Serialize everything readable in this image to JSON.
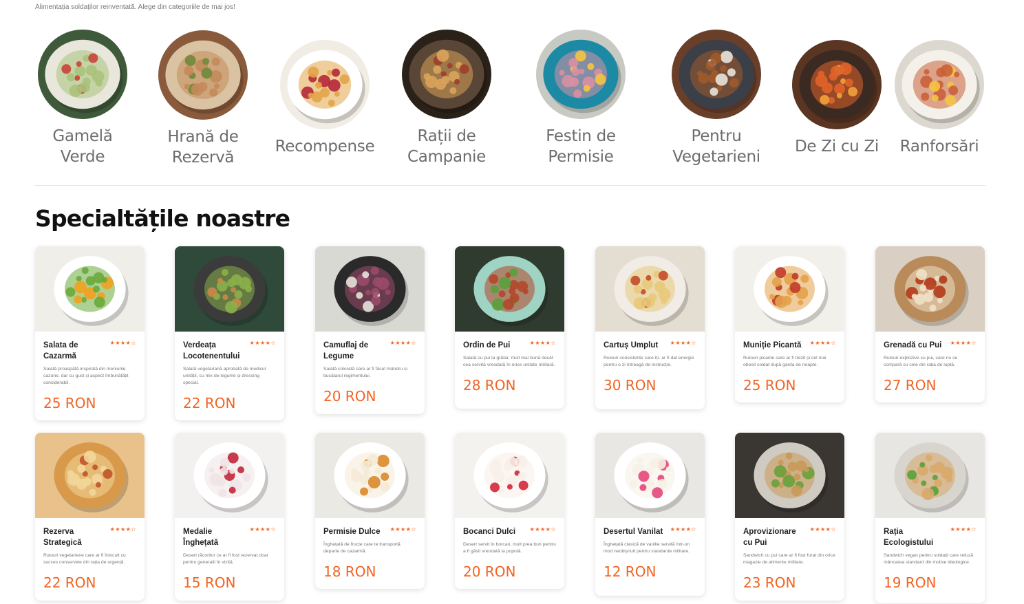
{
  "tagline": "Alimentația soldaților reinventată. Alege din categoriile de mai jos!",
  "categories": [
    {
      "label": "Gamelă\nVerde",
      "l1": "Gamelă",
      "l2": "Verde",
      "bg": "#3f5a3a",
      "plate": "#e9e6dc",
      "food": "#a9c27b",
      "accent": "#c9413a"
    },
    {
      "label": "Hrană de\nRezervă",
      "l1": "Hrană de",
      "l2": "Rezervă",
      "bg": "#8a5a3c",
      "plate": "#d9c3a3",
      "food": "#c48a5a",
      "accent": "#6e8a3a"
    },
    {
      "label": "Recompense",
      "l1": "Recompense",
      "l2": "",
      "bg": "#f1ece4",
      "plate": "#ffffff",
      "food": "#e2a548",
      "accent": "#b5283a"
    },
    {
      "label": "Rații de\nCampanie",
      "l1": "Rații de",
      "l2": "Campanie",
      "bg": "#2a2118",
      "plate": "#5a4636",
      "food": "#d9a35a",
      "accent": "#9c3d2b"
    },
    {
      "label": "Festin de\nPermisie",
      "l1": "Festin de",
      "l2": "Permisie",
      "bg": "#c7c9c3",
      "plate": "#1c8aa5",
      "food": "#d98fa4",
      "accent": "#f4c542"
    },
    {
      "label": "Pentru\nVegetarieni",
      "l1": "Pentru",
      "l2": "Vegetarieni",
      "bg": "#6a3f2a",
      "plate": "#3a3f48",
      "food": "#a05a2a",
      "accent": "#e9e4d9"
    },
    {
      "label": "De Zi cu Zi",
      "l1": "De Zi cu Zi",
      "l2": "",
      "bg": "#5a3522",
      "plate": "#3a2a22",
      "food": "#e0632a",
      "accent": "#f2a23a"
    },
    {
      "label": "Ranforsări",
      "l1": "Ranforsări",
      "l2": "",
      "bg": "#dcd8cf",
      "plate": "#f3f1ea",
      "food": "#c9623a",
      "accent": "#f3c443"
    }
  ],
  "section_title": "Specialtățile noastre",
  "products": [
    {
      "name": "Salata de Cazarmă",
      "stars": "★★★★☆",
      "desc": "Salată proaspătă inspirată din meniurile cazone, dar cu gust și aspect îmbunătățit considerabil.",
      "price": "25 RON",
      "bg": "#efeee9",
      "plate": "#ffffff",
      "food": "#6aa93a",
      "accent": "#f2a020"
    },
    {
      "name": "Verdeața Locotenentului",
      "stars": "★★★★☆",
      "desc": "Salată vegetariană aprobată de medicul unității, cu mix de legume și dressing special.",
      "price": "22 RON",
      "bg": "#2f4a3a",
      "plate": "#3b3b3b",
      "food": "#8bb04a",
      "accent": "#c98a4a"
    },
    {
      "name": "Camuflaj de Legume",
      "stars": "★★★★☆",
      "desc": "Salată colorată care ar fi făcut mândru și bucătarul regimentului.",
      "price": "20 RON",
      "bg": "#d9d9d4",
      "plate": "#2a2a2a",
      "food": "#9a4a6a",
      "accent": "#e6e2da"
    },
    {
      "name": "Ordin de Pui",
      "stars": "★★★★☆",
      "desc": "Salată cu pui la grătar, mult mai bună decât cea servită vreodată în orice unitate militară.",
      "price": "28 RON",
      "bg": "#2f3b2f",
      "plate": "#9fd3c4",
      "food": "#b2472a",
      "accent": "#5aa03a"
    },
    {
      "name": "Cartuș Umplut",
      "stars": "★★★★☆",
      "desc": "Rulouri consistente care îți- ar fi dat energie pentru o zi întreagă de instrucție.",
      "price": "30 RON",
      "bg": "#e4ddd2",
      "plate": "#f1ede6",
      "food": "#e8c97a",
      "accent": "#c44a2a"
    },
    {
      "name": "Muniție Picantă",
      "stars": "★★★★☆",
      "desc": "Rulouri picante care ar fi trezit și cel mai obosit soldat după garda de noapte.",
      "price": "25 RON",
      "bg": "#f2f0ea",
      "plate": "#ffffff",
      "food": "#e3a24a",
      "accent": "#c23a2a"
    },
    {
      "name": "Grenadă cu Pui",
      "stars": "★★★★☆",
      "desc": "Rulouri explozive cu pui, care nu se compară cu cele din rația de luptă.",
      "price": "27 RON",
      "bg": "#d9cfc2",
      "plate": "#b98a5a",
      "food": "#efe2c8",
      "accent": "#b23a1a"
    },
    {
      "name": "Rezerva Strategică",
      "stars": "★★★★☆",
      "desc": "Rulouri vegetariene care ar fi înlocuit cu succes conservele din rația de urgență.",
      "price": "22 RON",
      "bg": "#e8c28a",
      "plate": "#d89a4a",
      "food": "#f2d79a",
      "accent": "#c0552a"
    },
    {
      "name": "Medalie Înghețată",
      "stars": "★★★★☆",
      "desc": "Desert răcoritor ce ar fi fost rezervat doar pentru generalii în vizită.",
      "price": "15 RON",
      "bg": "#f2f1ef",
      "plate": "#ffffff",
      "food": "#efe4e6",
      "accent": "#c2283a"
    },
    {
      "name": "Permisie Dulce",
      "stars": "★★★★☆",
      "desc": "Înghețată de fructe care te transportă departe de cazarmă.",
      "price": "18 RON",
      "bg": "#ebe9e4",
      "plate": "#ffffff",
      "food": "#f4ead6",
      "accent": "#d98a2a"
    },
    {
      "name": "Bocanci Dulci",
      "stars": "★★★★☆",
      "desc": "Desert servit în borcan, mult prea bun pentru a fi găsit vreodată la popotă.",
      "price": "20 RON",
      "bg": "#f4f2ef",
      "plate": "#ffffff",
      "food": "#f7efe8",
      "accent": "#d4283a"
    },
    {
      "name": "Desertul Vanilat",
      "stars": "★★★★☆",
      "desc": "Înghețată clasică de vanilie servită într-un mod neobișnuit pentru standarde militare.",
      "price": "12 RON",
      "bg": "#e9e7e3",
      "plate": "#ffffff",
      "food": "#f6f1e6",
      "accent": "#e5467a"
    },
    {
      "name": "Aprovizionare cu Pui",
      "stars": "★★★★☆",
      "desc": "Sandwich cu pui care ar fi fost furat din orice magazie de alimente militare.",
      "price": "23 RON",
      "bg": "#3a3632",
      "plate": "#cfcac2",
      "food": "#c99a5a",
      "accent": "#6aa03a"
    },
    {
      "name": "Rația Ecologistului",
      "stars": "★★★★☆",
      "desc": "Sandwich vegan pentru soldații care refuză mâncarea standard din motive ideologice.",
      "price": "19 RON",
      "bg": "#e8e6e2",
      "plate": "#d8d4ce",
      "food": "#d9a86a",
      "accent": "#5aa03a"
    }
  ]
}
